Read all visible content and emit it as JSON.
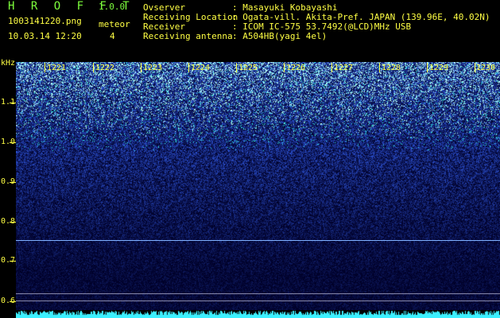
{
  "header": {
    "app_title": "H R O F F T",
    "app_version": "1.0.0",
    "filename": "1003141220.png",
    "datetime": "10.03.14 12:20",
    "meteor_label": "meteor",
    "meteor_count": "4",
    "fields": [
      {
        "label": "Ovserver",
        "value": ": Masayuki Kobayashi"
      },
      {
        "label": "Receiving Location",
        "value": ": Ogata-vill. Akita-Pref. JAPAN (139.96E, 40.02N)"
      },
      {
        "label": "Receiver",
        "value": ": ICOM IC-575 53.7492(@LCD)MHz USB"
      },
      {
        "label": "Receiving antenna",
        "value": ": A504HB(yagi 4el)"
      }
    ]
  },
  "spectrogram": {
    "y_unit": "kHz",
    "y_labels": [
      "1.1",
      "1.0",
      "0.9",
      "0.8",
      "0.7",
      "0.6"
    ],
    "x_labels": [
      "1221",
      "1222",
      "1223",
      "1224",
      "1225",
      "1226",
      "1227",
      "1228",
      "1229",
      "1230"
    ],
    "colors": {
      "text": "#ffff44",
      "title": "#7dff3c",
      "carrier": "#7fb0ff",
      "noise_dark": "#00003a",
      "noise_bright": "#3cf0ff"
    }
  }
}
